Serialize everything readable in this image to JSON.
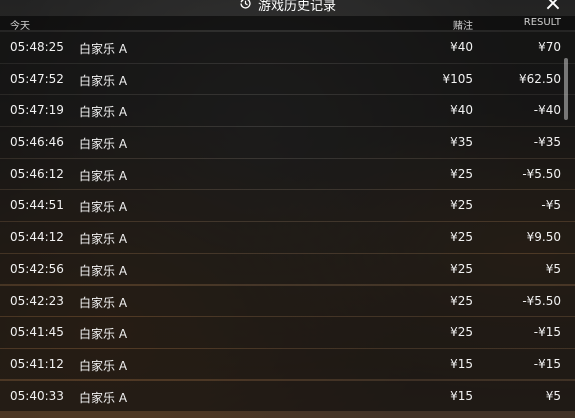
{
  "header": {
    "title": "游戏历史记录",
    "close_icon": "×"
  },
  "columns": {
    "date_label": "今天",
    "bet_label": "赌注",
    "result_label": "RESULT"
  },
  "rows": [
    {
      "time": "05:48:25",
      "game": "白家乐 A",
      "bet": "¥40",
      "result": "¥70"
    },
    {
      "time": "05:47:52",
      "game": "白家乐 A",
      "bet": "¥105",
      "result": "¥62.50"
    },
    {
      "time": "05:47:19",
      "game": "白家乐 A",
      "bet": "¥40",
      "result": "-¥40"
    },
    {
      "time": "05:46:46",
      "game": "白家乐 A",
      "bet": "¥35",
      "result": "-¥35"
    },
    {
      "time": "05:46:12",
      "game": "白家乐 A",
      "bet": "¥25",
      "result": "-¥5.50"
    },
    {
      "time": "05:44:51",
      "game": "白家乐 A",
      "bet": "¥25",
      "result": "-¥5"
    },
    {
      "time": "05:44:12",
      "game": "白家乐 A",
      "bet": "¥25",
      "result": "¥9.50"
    },
    {
      "time": "05:42:56",
      "game": "白家乐 A",
      "bet": "¥25",
      "result": "¥5"
    },
    {
      "time": "05:42:23",
      "game": "白家乐 A",
      "bet": "¥25",
      "result": "-¥5.50"
    },
    {
      "time": "05:41:45",
      "game": "白家乐 A",
      "bet": "¥25",
      "result": "-¥15"
    },
    {
      "time": "05:41:12",
      "game": "白家乐 A",
      "bet": "¥15",
      "result": "-¥15"
    },
    {
      "time": "05:40:33",
      "game": "白家乐 A",
      "bet": "¥15",
      "result": "¥5"
    }
  ]
}
